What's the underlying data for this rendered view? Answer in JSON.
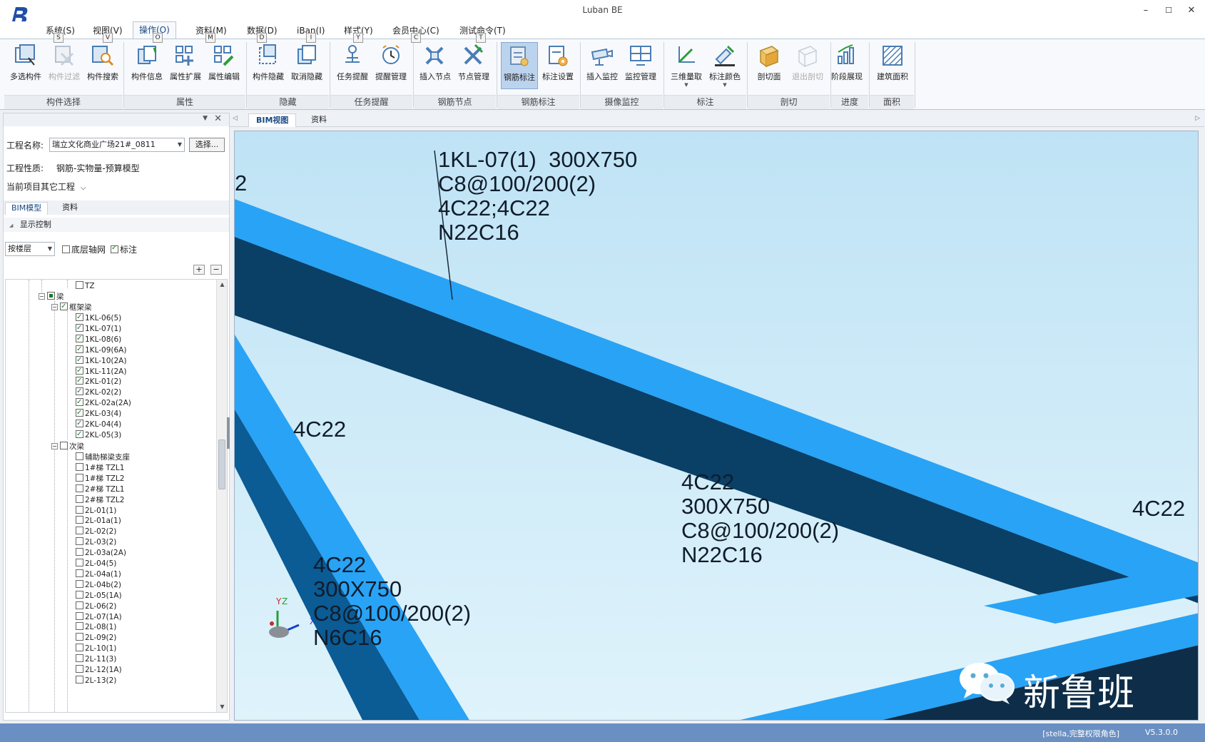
{
  "window": {
    "title": "Luban BE",
    "controls": {
      "minimize": "–",
      "maximize": "☐",
      "close": "✕"
    }
  },
  "menu": [
    {
      "label": "系统(S)",
      "key": "S"
    },
    {
      "label": "视图(V)",
      "key": "V"
    },
    {
      "label": "操作(O)",
      "key": "O",
      "active": true
    },
    {
      "label": "资料(M)",
      "key": "M"
    },
    {
      "label": "数据(D)",
      "key": "D"
    },
    {
      "label": "iBan(I)",
      "key": "I"
    },
    {
      "label": "样式(Y)",
      "key": "Y"
    },
    {
      "label": "会员中心(C)",
      "key": "C"
    },
    {
      "label": "测试命令(T)",
      "key": "T"
    }
  ],
  "ribbon": {
    "groups": [
      {
        "label": "构件选择",
        "buttons": [
          "多选构件",
          "构件过滤",
          "构件搜索"
        ]
      },
      {
        "label": "属性",
        "buttons": [
          "构件信息",
          "属性扩展",
          "属性编辑"
        ]
      },
      {
        "label": "隐藏",
        "buttons": [
          "构件隐藏",
          "取消隐藏"
        ]
      },
      {
        "label": "任务提醒",
        "buttons": [
          "任务提醒",
          "提醒管理"
        ]
      },
      {
        "label": "钢筋节点",
        "buttons": [
          "插入节点",
          "节点管理"
        ]
      },
      {
        "label": "钢筋标注",
        "buttons": [
          "钢筋标注",
          "标注设置"
        ]
      },
      {
        "label": "摄像监控",
        "buttons": [
          "插入监控",
          "监控管理"
        ]
      },
      {
        "label": "标注",
        "buttons": [
          "三维量取",
          "标注颜色"
        ]
      },
      {
        "label": "剖切",
        "buttons": [
          "剖切面",
          "退出剖切"
        ]
      },
      {
        "label": "进度",
        "buttons": [
          "阶段展现"
        ]
      },
      {
        "label": "面积",
        "buttons": [
          "建筑面积"
        ]
      }
    ]
  },
  "left_panel": {
    "project_label": "工程名称:",
    "project_value": "瑞立文化商业广场21#_0811",
    "choose_button": "选择...",
    "nature_label": "工程性质:",
    "nature_value": "钢筋-实物量-预算模型",
    "other_projects": "当前项目其它工程",
    "tabs": [
      "BIM模型",
      "资料"
    ],
    "display_control": "显示控制",
    "floor_mode": "按楼层",
    "bottom_grid_label": "底层轴网",
    "annotation_label": "标注",
    "tree": {
      "top_item": "TZ",
      "beam": "梁",
      "frame_beam": "框架梁",
      "frame_items": [
        "1KL-06(5)",
        "1KL-07(1)",
        "1KL-08(6)",
        "1KL-09(6A)",
        "1KL-10(2A)",
        "1KL-11(2A)",
        "2KL-01(2)",
        "2KL-02(2)",
        "2KL-02a(2A)",
        "2KL-03(4)",
        "2KL-04(4)",
        "2KL-05(3)"
      ],
      "secondary_beam": "次梁",
      "secondary_items": [
        "辅助梯梁支座",
        "1#梯 TZL1",
        "1#梯 TZL2",
        "2#梯 TZL1",
        "2#梯 TZL2",
        "2L-01(1)",
        "2L-01a(1)",
        "2L-02(2)",
        "2L-03(2)",
        "2L-03a(2A)",
        "2L-04(5)",
        "2L-04a(1)",
        "2L-04b(2)",
        "2L-05(1A)",
        "2L-06(2)",
        "2L-07(1A)",
        "2L-08(1)",
        "2L-09(2)",
        "2L-10(1)",
        "2L-11(3)",
        "2L-12(1A)",
        "2L-13(2)"
      ]
    }
  },
  "doc_tabs": [
    "BIM视图",
    "资料"
  ],
  "viewport": {
    "label_edge": "2",
    "label_top": [
      "1KL-07(1)  300X750",
      "C8@100/200(2)",
      "4C22;4C22",
      "N22C16"
    ],
    "label_mid_left": "4C22",
    "label_center": [
      "4C22",
      "300X750",
      "C8@100/200(2)",
      "N22C16"
    ],
    "label_right": "4C22",
    "label_bottom_left": [
      "4C22",
      "300X750",
      "C8@100/200(2)",
      "N6C16"
    ],
    "axis_y": "Y",
    "axis_z": "Z",
    "axis_x": "X",
    "watermark": "新鲁班",
    "colors": {
      "beam_light": "#29a3f5",
      "beam_dark": "#0a3f66",
      "background": "#c7e7f6"
    }
  },
  "status": {
    "user": "[stella,完整权限角色]",
    "version": "V5.3.0.0"
  }
}
